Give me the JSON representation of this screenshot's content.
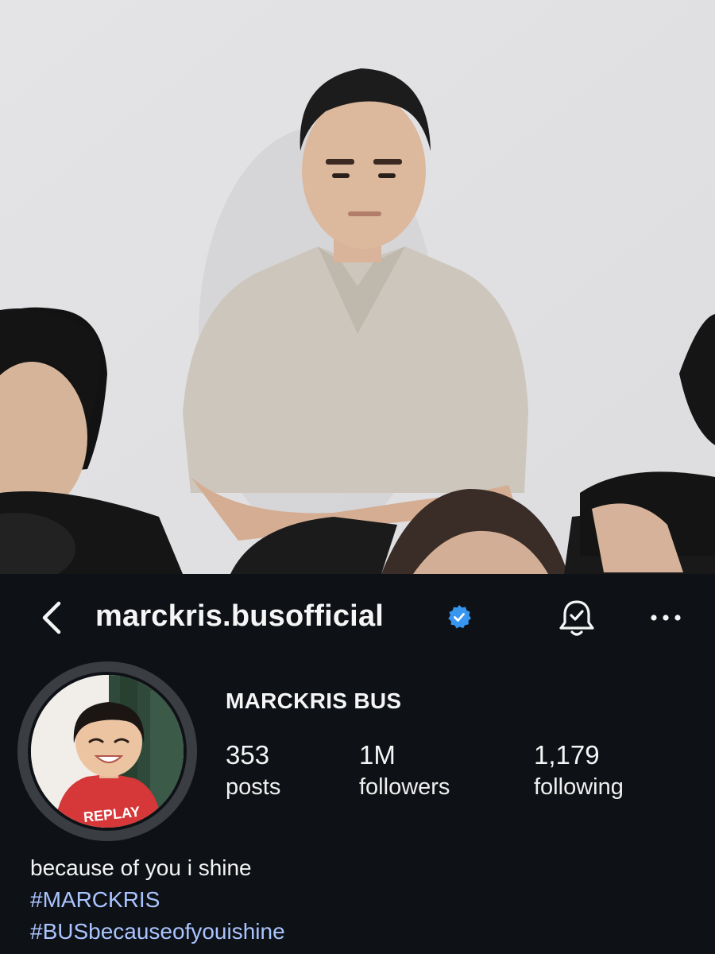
{
  "header": {
    "username": "marckris.busofficial",
    "back_icon": "chevron-left-icon",
    "verified_icon": "verified-badge-icon",
    "notifications_icon": "bell-check-icon",
    "more_icon": "more-horizontal-icon"
  },
  "profile": {
    "display_name": "MARCKRIS BUS",
    "stats": [
      {
        "value": "353",
        "label": "posts"
      },
      {
        "value": "1M",
        "label": "followers"
      },
      {
        "value": "1,179",
        "label": "following"
      }
    ],
    "bio": {
      "text": "because of you i shine",
      "hashtags": [
        "#MARCKRIS",
        "#BUSbecauseofyouishine"
      ]
    }
  },
  "colors": {
    "background": "#0e1116",
    "text": "#f5f5f5",
    "hashtag": "#aac4ff",
    "verified_blue": "#3797f0",
    "avatar_ring": "#3a3d42"
  }
}
